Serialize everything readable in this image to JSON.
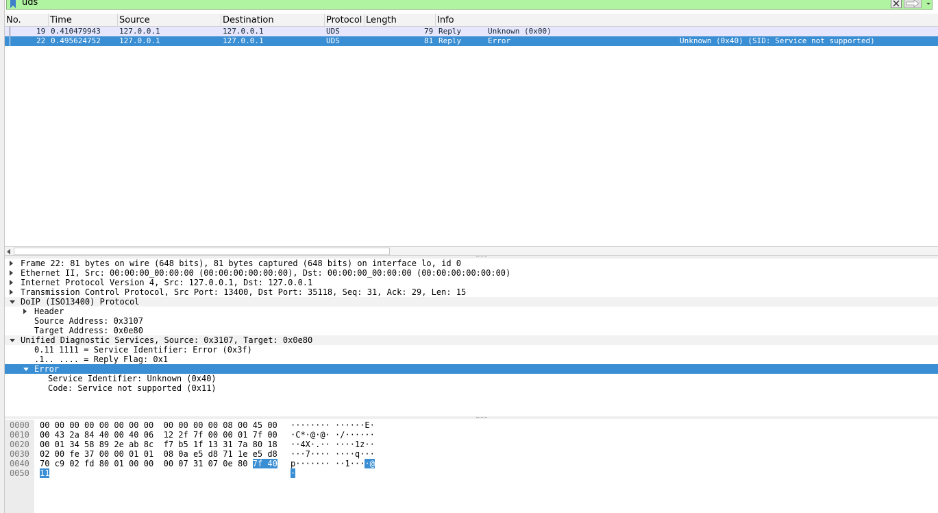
{
  "filter": {
    "value": "uds"
  },
  "packet_list": {
    "columns": [
      "No.",
      "Time",
      "Source",
      "Destination",
      "Protocol",
      "Length",
      "Info"
    ],
    "rows": [
      {
        "no": "19",
        "time": "0.410479943",
        "source": "127.0.0.1",
        "destination": "127.0.0.1",
        "protocol": "UDS",
        "length": "79",
        "info_type": "Reply",
        "info_a": "Unknown (0x00)",
        "info_b": "",
        "selected": false
      },
      {
        "no": "22",
        "time": "0.495624752",
        "source": "127.0.0.1",
        "destination": "127.0.0.1",
        "protocol": "UDS",
        "length": "81",
        "info_type": "Reply",
        "info_a": "Error",
        "info_b": "Unknown (0x40) (SID: Service not supported)",
        "selected": true
      }
    ]
  },
  "details": {
    "rows": [
      {
        "text": "Frame 22: 81 bytes on wire (648 bits), 81 bytes captured (648 bits) on interface lo, id 0",
        "level": 0,
        "expander": "collapsed",
        "alt": false,
        "selected": false
      },
      {
        "text": "Ethernet II, Src: 00:00:00_00:00:00 (00:00:00:00:00:00), Dst: 00:00:00_00:00:00 (00:00:00:00:00:00)",
        "level": 0,
        "expander": "collapsed",
        "alt": false,
        "selected": false
      },
      {
        "text": "Internet Protocol Version 4, Src: 127.0.0.1, Dst: 127.0.0.1",
        "level": 0,
        "expander": "collapsed",
        "alt": false,
        "selected": false
      },
      {
        "text": "Transmission Control Protocol, Src Port: 13400, Dst Port: 35118, Seq: 31, Ack: 29, Len: 15",
        "level": 0,
        "expander": "collapsed",
        "alt": false,
        "selected": false
      },
      {
        "text": "DoIP (ISO13400) Protocol",
        "level": 0,
        "expander": "expanded",
        "alt": true,
        "selected": false
      },
      {
        "text": "Header",
        "level": 1,
        "expander": "collapsed",
        "alt": false,
        "selected": false
      },
      {
        "text": "Source Address: 0x3107",
        "level": 1,
        "expander": "none",
        "alt": false,
        "selected": false
      },
      {
        "text": "Target Address: 0x0e80",
        "level": 1,
        "expander": "none",
        "alt": false,
        "selected": false
      },
      {
        "text": "Unified Diagnostic Services, Source: 0x3107, Target: 0x0e80",
        "level": 0,
        "expander": "expanded",
        "alt": true,
        "selected": false
      },
      {
        "text": "0.11 1111 = Service Identifier: Error (0x3f)",
        "level": 1,
        "expander": "none",
        "alt": false,
        "selected": false
      },
      {
        "text": ".1.. .... = Reply Flag: 0x1",
        "level": 1,
        "expander": "none",
        "alt": false,
        "selected": false
      },
      {
        "text": "Error",
        "level": 1,
        "expander": "expanded",
        "alt": false,
        "selected": true
      },
      {
        "text": "Service Identifier: Unknown (0x40)",
        "level": 2,
        "expander": "none",
        "alt": false,
        "selected": false
      },
      {
        "text": "Code: Service not supported (0x11)",
        "level": 2,
        "expander": "none",
        "alt": false,
        "selected": false
      }
    ]
  },
  "bytes": {
    "rows": [
      {
        "offset": "0000",
        "hex": "00 00 00 00 00 00 00 00  00 00 00 00 08 00 45 00",
        "hex_hl": "",
        "ascii": "········ ······E·",
        "ascii_hl": ""
      },
      {
        "offset": "0010",
        "hex": "00 43 2a 84 40 00 40 06  12 2f 7f 00 00 01 7f 00",
        "hex_hl": "",
        "ascii": "·C*·@·@· ·/······",
        "ascii_hl": ""
      },
      {
        "offset": "0020",
        "hex": "00 01 34 58 89 2e ab 8c  f7 b5 1f 13 31 7a 80 18",
        "hex_hl": "",
        "ascii": "··4X·.·· ····1z··",
        "ascii_hl": ""
      },
      {
        "offset": "0030",
        "hex": "02 00 fe 37 00 00 01 01  08 0a e5 d8 71 1e e5 d8",
        "hex_hl": "",
        "ascii": "···7···· ····q···",
        "ascii_hl": ""
      },
      {
        "offset": "0040",
        "hex": "70 c9 02 fd 80 01 00 00  00 07 31 07 0e 80 ",
        "hex_hl": "7f 40",
        "ascii": "p······· ··1···",
        "ascii_hl": "·@"
      },
      {
        "offset": "0050",
        "hex": "",
        "hex_hl": "11",
        "ascii": "",
        "ascii_hl": "·"
      }
    ]
  }
}
